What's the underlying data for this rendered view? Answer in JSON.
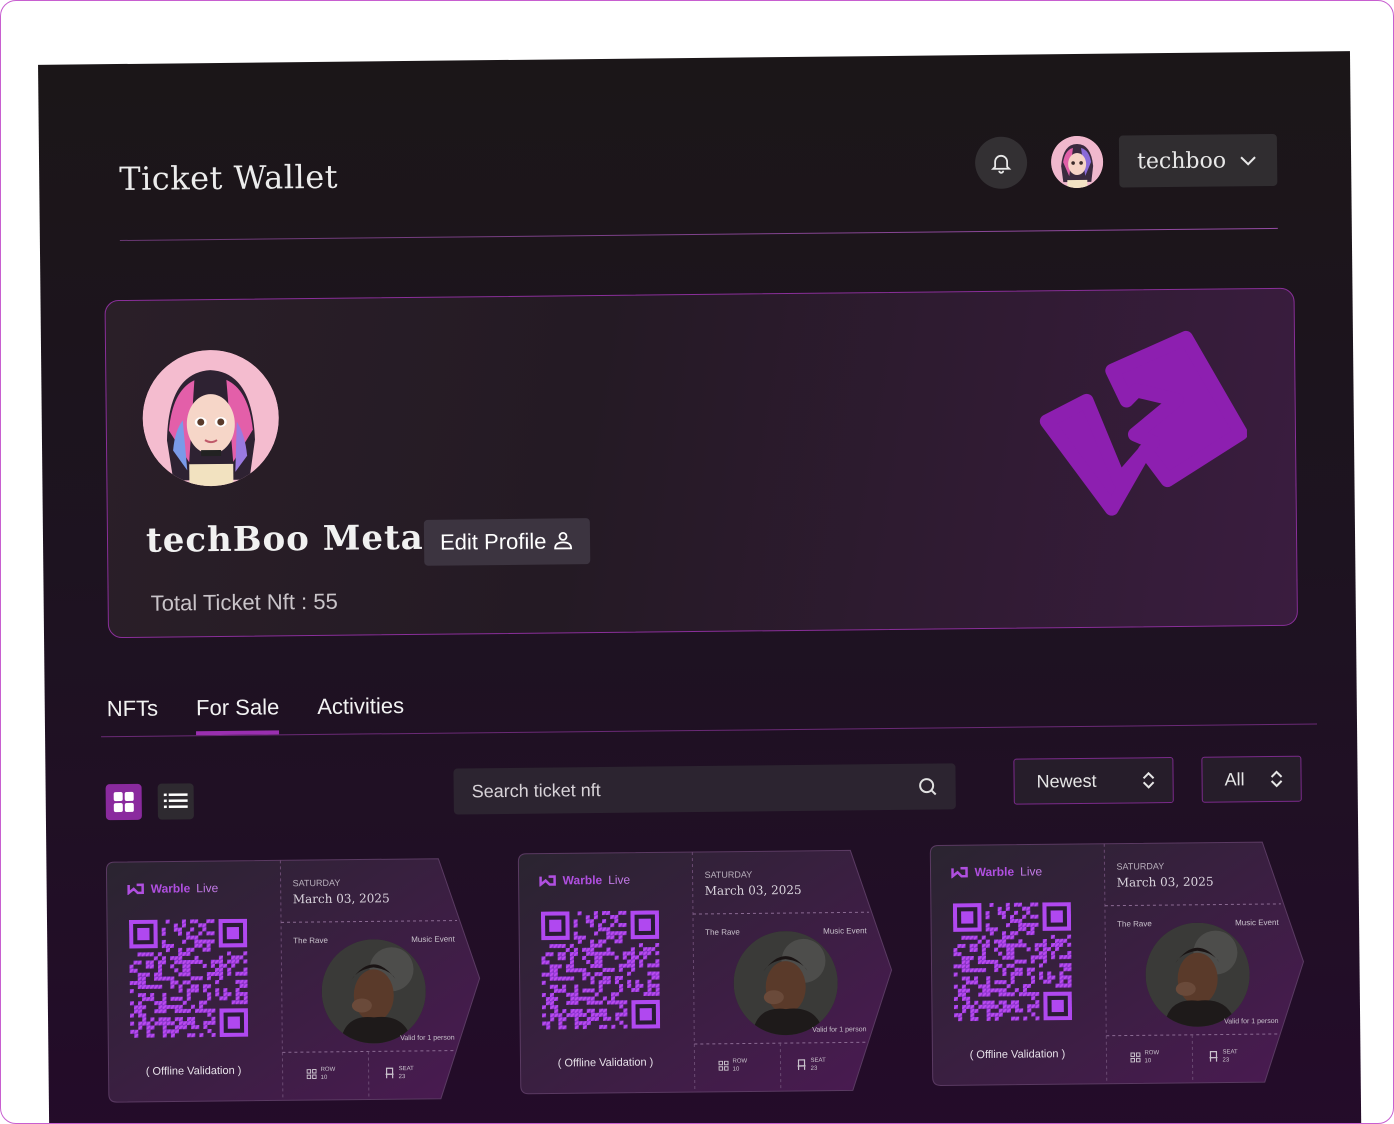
{
  "header": {
    "title": "Ticket Wallet",
    "username": "techboo"
  },
  "profile": {
    "name": "techBoo Meta",
    "edit_label": "Edit Profile",
    "total_label": "Total Ticket Nft : 55"
  },
  "tabs": [
    {
      "label": "NFTs",
      "active": false
    },
    {
      "label": "For Sale",
      "active": true
    },
    {
      "label": "Activities",
      "active": false
    }
  ],
  "toolbar": {
    "search_placeholder": "Search ticket nft",
    "sort_value": "Newest",
    "filter_value": "All"
  },
  "tickets": [
    {
      "brand_a": "Warble",
      "brand_b": "Live",
      "validation": "( Offline Validation )",
      "day": "SATURDAY",
      "date": "March 03, 2025",
      "event": "The Rave",
      "category": "Music Event",
      "valid": "Valid for 1 person",
      "row_label": "ROW",
      "row_value": "10",
      "seat_label": "SEAT",
      "seat_value": "23"
    },
    {
      "brand_a": "Warble",
      "brand_b": "Live",
      "validation": "( Offline Validation )",
      "day": "SATURDAY",
      "date": "March 03, 2025",
      "event": "The Rave",
      "category": "Music Event",
      "valid": "Valid for 1 person",
      "row_label": "ROW",
      "row_value": "10",
      "seat_label": "SEAT",
      "seat_value": "23"
    },
    {
      "brand_a": "Warble",
      "brand_b": "Live",
      "validation": "( Offline Validation )",
      "day": "SATURDAY",
      "date": "March 03, 2025",
      "event": "The Rave",
      "category": "Music Event",
      "valid": "Valid for 1 person",
      "row_label": "ROW",
      "row_value": "10",
      "seat_label": "SEAT",
      "seat_value": "23"
    }
  ],
  "colors": {
    "accent": "#9a2fb0",
    "panel_bg": "#1b1618",
    "qr_purple": "#a040e0"
  },
  "icons": [
    "bell-icon",
    "chevron-down-icon",
    "user-icon",
    "grid-icon",
    "list-icon",
    "search-icon",
    "sort-chevrons-icon",
    "warblelive-logo-icon",
    "seat-icon",
    "qr-code"
  ]
}
